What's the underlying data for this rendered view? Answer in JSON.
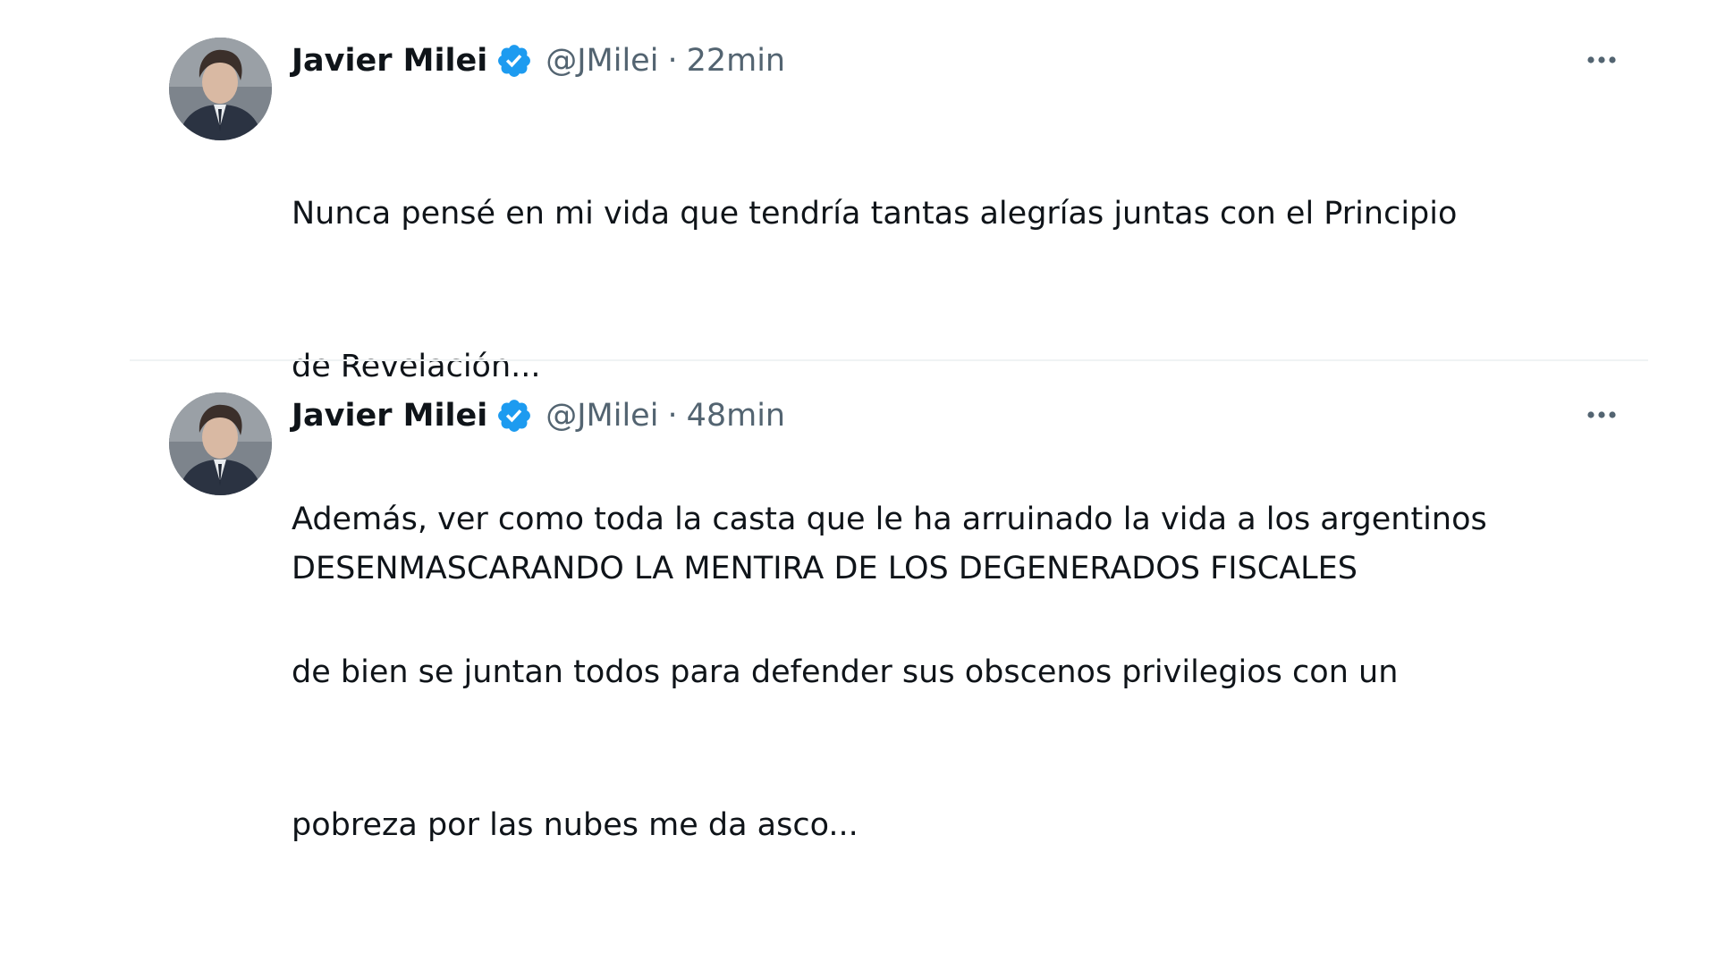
{
  "tweets": [
    {
      "author_name": "Javier Milei",
      "handle": "@JMilei",
      "separator": "·",
      "time": "22min",
      "verified_icon": "verified-badge-icon",
      "lines": [
        "Nunca pensé en mi vida que tendría tantas alegrías juntas con el Principio",
        "de Revelación...",
        "Además, ver como toda la casta que le ha arruinado la vida a los argentinos",
        "de bien se juntan todos para defender sus obscenos privilegios con un",
        "pobreza por las nubes me da asco..."
      ]
    },
    {
      "author_name": "Javier Milei",
      "handle": "@JMilei",
      "separator": "·",
      "time": "48min",
      "verified_icon": "verified-badge-icon",
      "lines": [
        "DESENMASCARANDO LA MENTIRA DE LOS DEGENERADOS FISCALES"
      ]
    }
  ],
  "colors": {
    "text": "#0f1419",
    "secondary": "#536471",
    "verified": "#1d9bf0",
    "divider": "#eff3f4"
  }
}
